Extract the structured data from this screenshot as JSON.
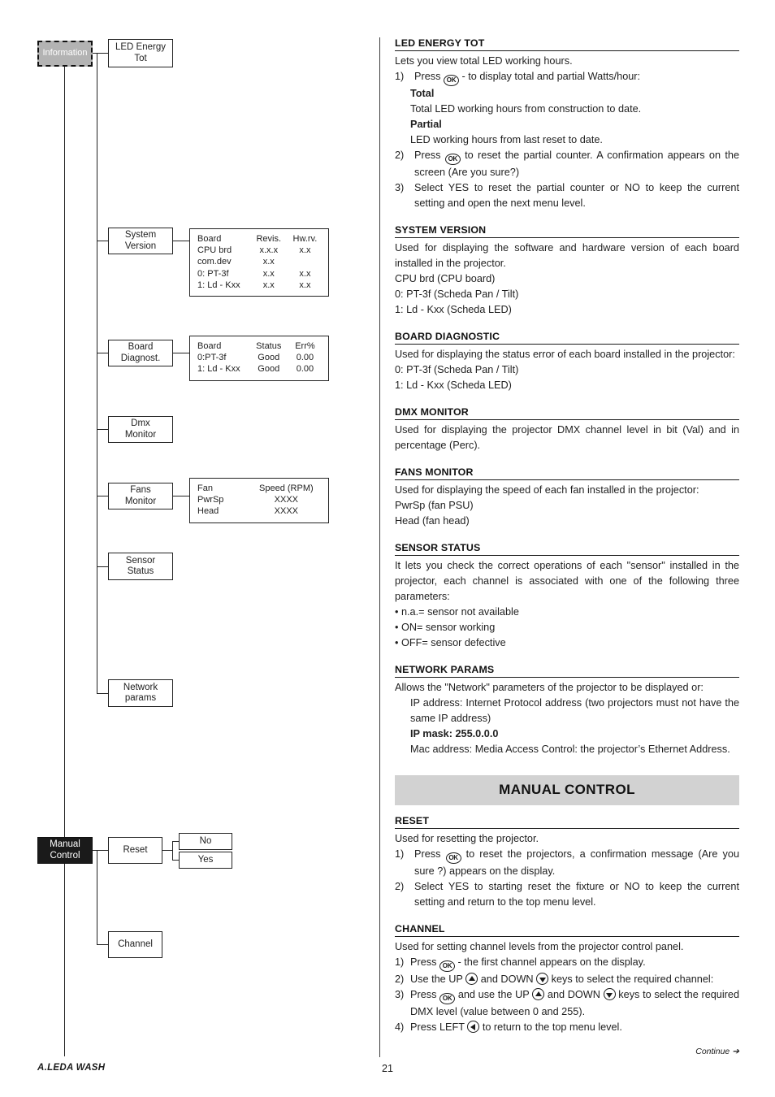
{
  "page": {
    "number": "21",
    "brand": "A.LEDA WASH",
    "continue": "Continue",
    "continue_arrow": "➔"
  },
  "diagram": {
    "information_root": "Information",
    "manual_root": "Manual\nControl",
    "nodes": {
      "led_energy_tot": "LED Energy\nTot",
      "system_version": "System\nVersion",
      "board_diagnost": "Board\nDiagnost.",
      "dmx_monitor": "Dmx\nMonitor",
      "fans_monitor": "Fans\nMonitor",
      "sensor_status": "Sensor\nStatus",
      "network_params": "Network\nparams",
      "reset": "Reset",
      "channel": "Channel",
      "no": "No",
      "yes": "Yes"
    },
    "system_version_table": {
      "headers": [
        "Board",
        "Revis.",
        "Hw.rv."
      ],
      "rows": [
        [
          "CPU brd",
          "x.x.x",
          "x.x"
        ],
        [
          "com.dev",
          "x.x",
          ""
        ],
        [
          "0: PT-3f",
          "x.x",
          "x.x"
        ],
        [
          "1: Ld - Kxx",
          "x.x",
          "x.x"
        ]
      ]
    },
    "board_diagnost_table": {
      "headers": [
        "Board",
        "Status",
        "Err%"
      ],
      "rows": [
        [
          "0:PT-3f",
          "Good",
          "0.00"
        ],
        [
          "1: Ld - Kxx",
          "Good",
          "0.00"
        ]
      ]
    },
    "fans_monitor_table": {
      "headers": [
        "Fan",
        "Speed (RPM)",
        ""
      ],
      "rows": [
        [
          "PwrSp",
          "XXXX",
          ""
        ],
        [
          "Head",
          "XXXX",
          ""
        ]
      ]
    }
  },
  "sections": {
    "led_energy_tot": {
      "title": "LED ENERGY TOT",
      "intro": "Lets you view total LED working hours.",
      "item1_num": "1)",
      "item1_a": "Press",
      "item1_b": "- to display total and partial Watts/hour:",
      "total_label": "Total",
      "total_text": "Total LED working hours from construction to date.",
      "partial_label": "Partial",
      "partial_text": "LED working hours from last reset to date.",
      "item2_num": "2)",
      "item2_a": "Press",
      "item2_b": "to reset the partial counter. A confirmation appears on the screen (Are you sure?)",
      "item3_num": "3)",
      "item3_text": "Select YES to reset the partial counter or NO to keep the current setting and open the next menu level."
    },
    "system_version": {
      "title": "SYSTEM VERSION",
      "body": "Used for displaying the software and hardware version of each board installed in the projector.",
      "line1": "CPU brd (CPU board)",
      "line2": "0: PT-3f (Scheda Pan / Tilt)",
      "line3": "1: Ld - Kxx (Scheda LED)"
    },
    "board_diagnostic": {
      "title": "BOARD DIAGNOSTIC",
      "body": "Used for displaying the status error of each board installed in the projector:",
      "line1": "0: PT-3f (Scheda Pan / Tilt)",
      "line2": "1: Ld - Kxx (Scheda LED)"
    },
    "dmx_monitor": {
      "title": "DMX MONITOR",
      "body": "Used for displaying the projector DMX channel level in bit (Val) and in percentage (Perc)."
    },
    "fans_monitor": {
      "title": "FANS MONITOR",
      "body": "Used for displaying the speed of each fan installed in the projector:",
      "line1": "PwrSp (fan PSU)",
      "line2": "Head (fan head)"
    },
    "sensor_status": {
      "title": "SENSOR STATUS",
      "body": "It lets you check the correct operations of each \"sensor\" installed in the projector, each channel is associated with one of the following three parameters:",
      "bullet1": "• n.a.= sensor not available",
      "bullet2": "• ON= sensor working",
      "bullet3": "• OFF= sensor defective"
    },
    "network_params": {
      "title": "NETWORK PARAMS",
      "body": "Allows the \"Network\" parameters of the projector to be displayed or:",
      "ip_address_label": "IP address:",
      "ip_address_text": "Internet Protocol address (two projectors must not have the same IP address)",
      "ip_mask": "IP mask: 255.0.0.0",
      "mac_label": "Mac address:",
      "mac_text": "Media Access Control: the projector’s Ethernet Address."
    },
    "manual_control_banner": "MANUAL CONTROL",
    "reset": {
      "title": "RESET",
      "body": "Used for resetting the projector.",
      "item1_num": "1)",
      "item1_a": "Press",
      "item1_b": "to reset the projectors, a confirmation message (Are you sure ?) appears on the display.",
      "item2_num": "2)",
      "item2_text": "Select YES to starting reset the fixture or NO to keep the current setting and return to the top menu level."
    },
    "channel": {
      "title": "CHANNEL",
      "body": "Used for setting channel levels from the projector control panel.",
      "item1_num": "1)",
      "item1_a": "Press",
      "item1_b": "- the first channel appears on the display.",
      "item2_num": "2)",
      "item2_a": "Use the UP",
      "item2_b": "and DOWN",
      "item2_c": "keys to select the required channel:",
      "item3_num": "3)",
      "item3_a": "Press",
      "item3_b": "and use the UP",
      "item3_c": "and DOWN",
      "item3_d": "keys to select the required DMX level (value between 0 and 255).",
      "item4_num": "4)",
      "item4_a": "Press LEFT",
      "item4_b": "to return to the top menu level."
    }
  },
  "icons": {
    "ok": "OK"
  }
}
